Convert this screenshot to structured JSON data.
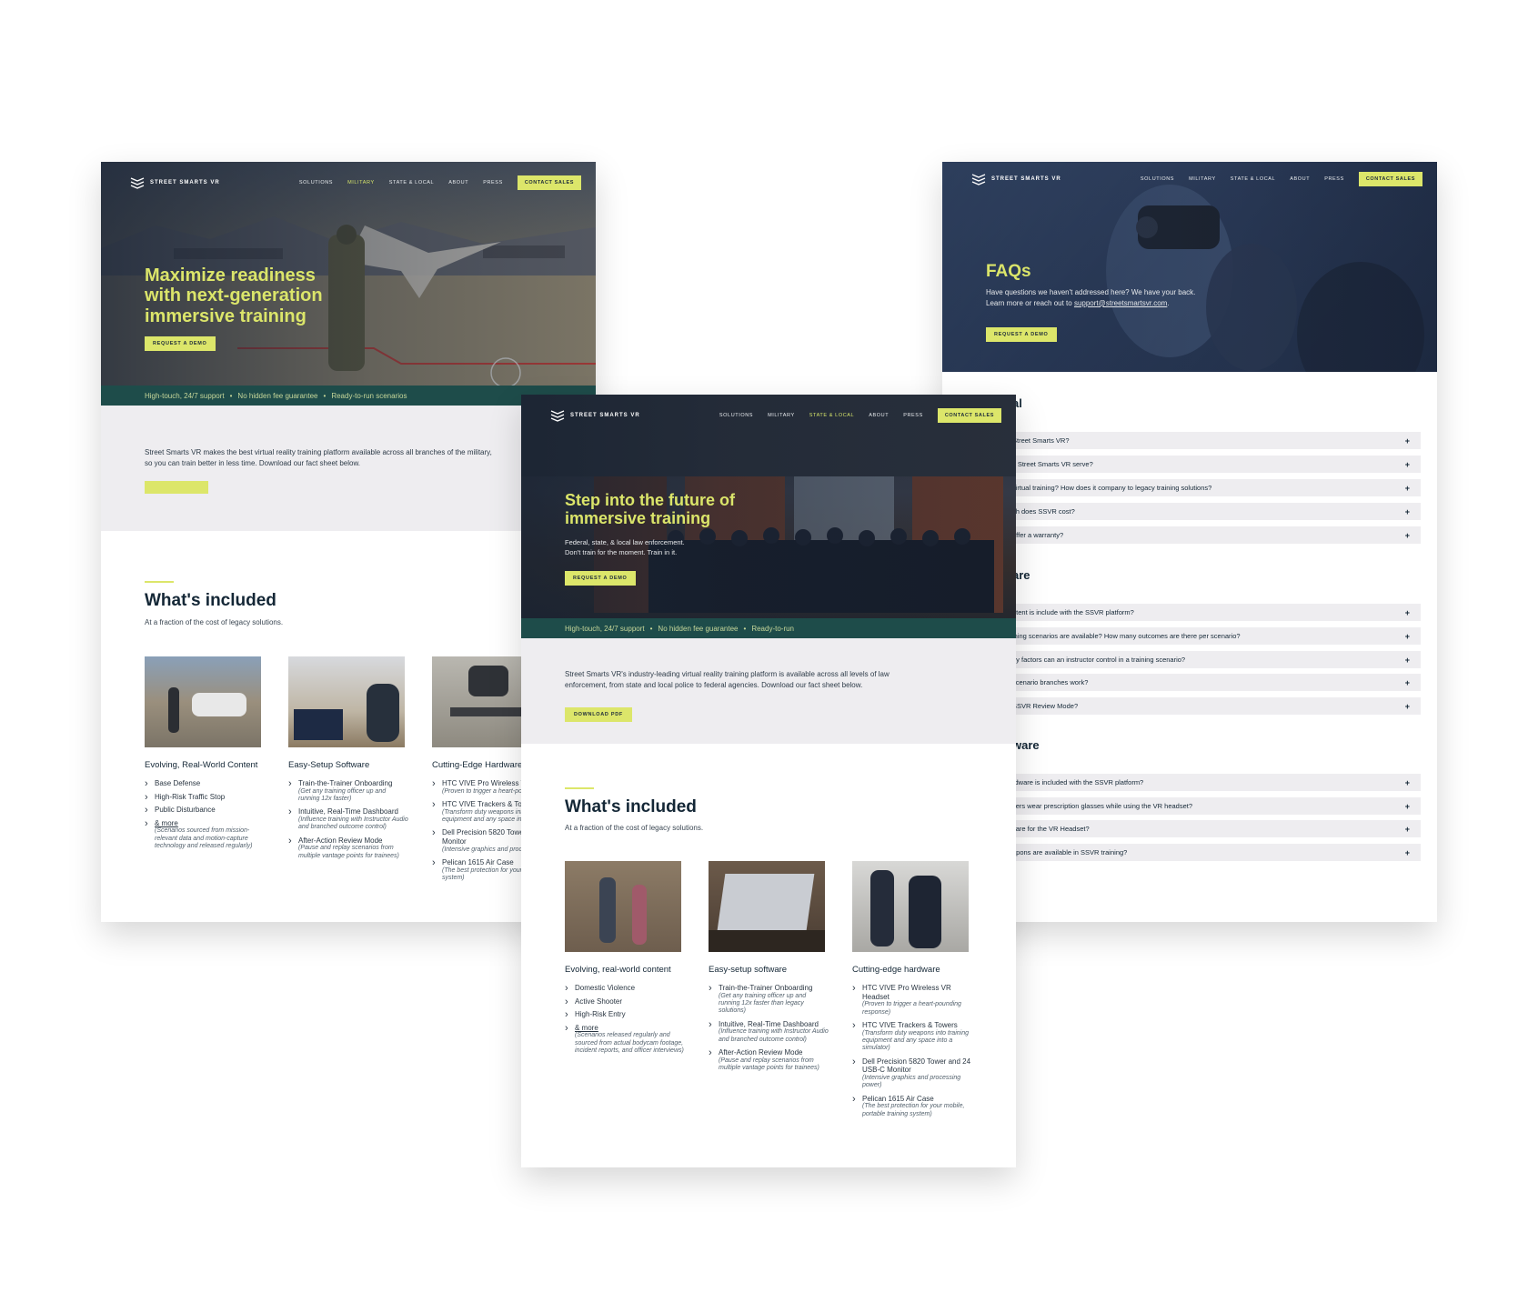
{
  "brand": {
    "name": "STREET SMARTS VR",
    "accent": "#dce66a",
    "dark": "#142736",
    "bar": "#1e4c4a"
  },
  "nav": {
    "items": [
      "SOLUTIONS",
      "MILITARY",
      "STATE & LOCAL",
      "ABOUT",
      "PRESS"
    ],
    "cta": "CONTACT SALES"
  },
  "military": {
    "hero_title": "Maximize readiness with next-generation immersive training",
    "hero_button": "REQUEST A DEMO",
    "bullets": [
      "High-touch, 24/7 support",
      "No hidden fee guarantee",
      "Ready-to-run scenarios"
    ],
    "intro": "Street Smarts VR makes the best virtual reality training platform available across all branches of the military, so you can train better in less time. Download our fact sheet below.",
    "included_title": "What's included",
    "included_sub": "At a fraction of the cost of legacy solutions.",
    "columns": [
      {
        "title": "Evolving, Real-World Content",
        "items": [
          {
            "text": "Base Defense",
            "note": ""
          },
          {
            "text": "High-Risk Traffic Stop",
            "note": ""
          },
          {
            "text": "Public Disturbance",
            "note": ""
          },
          {
            "text": "& more",
            "note": "(Scenarios sourced from mission-relevant data and motion-capture technology and released regularly)"
          }
        ]
      },
      {
        "title": "Easy-Setup Software",
        "items": [
          {
            "text": "Train-the-Trainer Onboarding",
            "note": "(Get any training officer up and running 12x faster)"
          },
          {
            "text": "Intuitive, Real-Time Dashboard",
            "note": "(Influence training with Instructor Audio and branched outcome control)"
          },
          {
            "text": "After-Action Review Mode",
            "note": "(Pause and replay scenarios from multiple vantage points for trainees)"
          }
        ]
      },
      {
        "title": "Cutting-Edge Hardware",
        "items": [
          {
            "text": "HTC VIVE Pro Wireless V",
            "note": "(Proven to trigger a heart-poun"
          },
          {
            "text": "HTC VIVE Trackers & Tow",
            "note": "(Transform duty weapons into equipment and any space into"
          },
          {
            "text": "Dell Precision 5820 Towe USB-C Monitor",
            "note": "(Intensive graphics and process"
          },
          {
            "text": "Pelican 1615 Air Case",
            "note": "(The best protection for your m training system)"
          }
        ]
      }
    ]
  },
  "state": {
    "hero_title": "Step into the future of immersive training",
    "hero_sub": "Federal, state, & local law enforcement. Don't train for the moment. Train in it.",
    "hero_button": "REQUEST A DEMO",
    "bullets": [
      "High-touch, 24/7 support",
      "No hidden fee guarantee",
      "Ready-to-run"
    ],
    "intro": "Street Smarts VR's industry-leading virtual reality training platform is available across all levels of law enforcement, from state and local police to federal agencies. Download our fact sheet below.",
    "intro_button": "DOWNLOAD PDF",
    "included_title": "What's included",
    "included_sub": "At a fraction of the cost of legacy solutions.",
    "columns": [
      {
        "title": "Evolving, real-world content",
        "items": [
          {
            "text": "Domestic Violence",
            "note": ""
          },
          {
            "text": "Active Shooter",
            "note": ""
          },
          {
            "text": "High-Risk Entry",
            "note": ""
          },
          {
            "text": "& more",
            "note": "(Scenarios released regularly and sourced from actual bodycam footage, incident reports, and officer interviews)"
          }
        ]
      },
      {
        "title": "Easy-setup software",
        "items": [
          {
            "text": "Train-the-Trainer Onboarding",
            "note": "(Get any training officer up and running 12x faster than legacy solutions)"
          },
          {
            "text": "Intuitive, Real-Time Dashboard",
            "note": "(Influence training with Instructor Audio and branched outcome control)"
          },
          {
            "text": "After-Action Review Mode",
            "note": "(Pause and replay scenarios from multiple vantage points for trainees)"
          }
        ]
      },
      {
        "title": "Cutting-edge hardware",
        "items": [
          {
            "text": "HTC VIVE Pro Wireless VR Headset",
            "note": "(Proven to trigger a heart-pounding response)"
          },
          {
            "text": "HTC VIVE Trackers & Towers",
            "note": "(Transform duty weapons into training equipment and any space into a simulator)"
          },
          {
            "text": "Dell Precision 5820 Tower and 24 USB-C Monitor",
            "note": "(Intensive graphics and processing power)"
          },
          {
            "text": "Pelican 1615 Air Case",
            "note": "(The best protection for your mobile, portable training system)"
          }
        ]
      }
    ]
  },
  "faq": {
    "hero_title": "FAQs",
    "hero_sub_1": "Have questions we haven't addressed here? We have your back.",
    "hero_sub_2_prefix": "Learn more or reach out to ",
    "hero_email": "support@streetsmartsvr.com",
    "hero_sub_2_suffix": ".",
    "hero_button": "REQUEST A DEMO",
    "groups": [
      {
        "title": "al",
        "questions": [
          "Street Smarts VR?",
          "s Street Smarts VR serve?",
          "virtual training? How does it company to legacy training solutions?",
          "ch does SSVR cost?",
          "offer a warranty?"
        ]
      },
      {
        "title": "are",
        "questions": [
          "ntent is include with the SSVR platform?",
          "ining scenarios are available? How many outcomes are there per scenario?",
          "ny factors can an instructor control in a training scenario?",
          "scenario branches work?",
          "SSVR Review Mode?"
        ]
      },
      {
        "title": "ware",
        "questions": [
          "rdware is included with the SSVR platform?",
          "cers wear prescription glasses while using the VR headset?",
          "care for the VR Headset?",
          "apons are available in SSVR training?"
        ]
      }
    ],
    "plus": "+"
  }
}
